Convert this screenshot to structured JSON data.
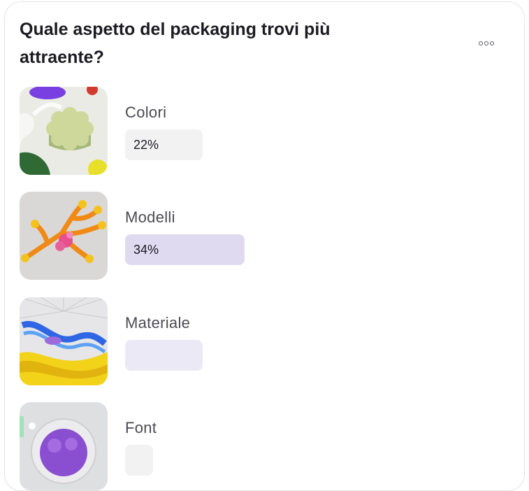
{
  "poll": {
    "question": "Quale aspetto del packaging trovi più attraente?",
    "more_icon": "more-options-icon",
    "options": [
      {
        "label": "Colori",
        "percent_label": "22%",
        "share": 0.22,
        "bar_color": "#f2f2f3",
        "image": "green-flower-shape-image"
      },
      {
        "label": "Modelli",
        "percent_label": "34%",
        "share": 0.34,
        "bar_color": "#e0daf1",
        "image": "orange-coral-image"
      },
      {
        "label": "Materiale",
        "percent_label": "",
        "share": 0.22,
        "bar_color": "#ece9f6",
        "image": "blue-yellow-wave-image"
      },
      {
        "label": "Font",
        "percent_label": "",
        "share": 0.0,
        "bar_color": "#f2f2f3",
        "image": "purple-fluff-image"
      }
    ]
  }
}
